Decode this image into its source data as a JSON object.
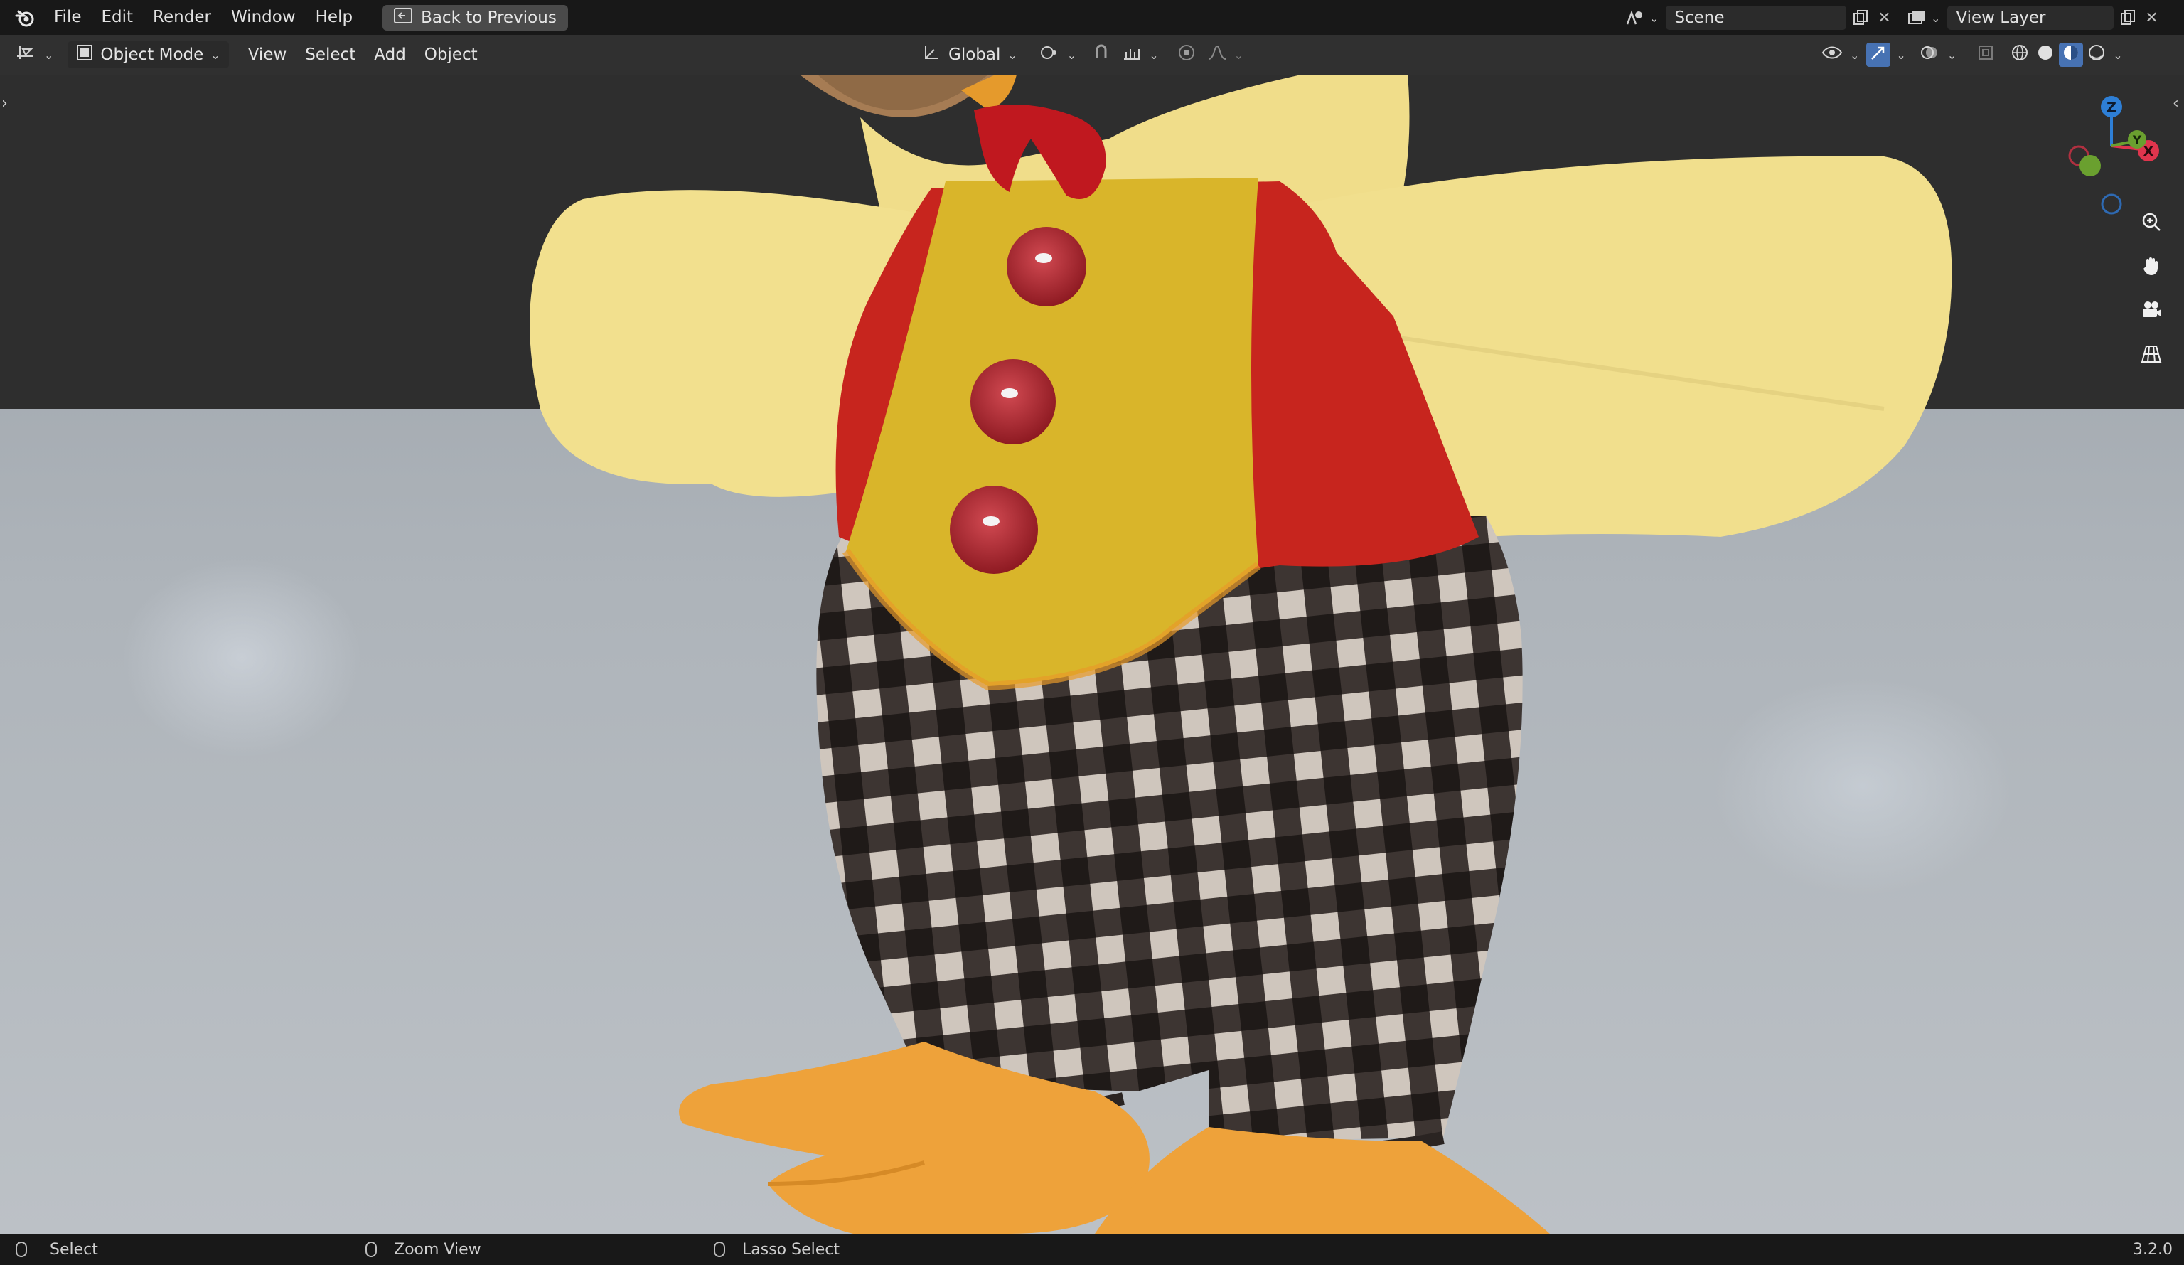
{
  "menu": {
    "items": [
      "File",
      "Edit",
      "Render",
      "Window",
      "Help"
    ],
    "back_button": "Back to Previous"
  },
  "topright": {
    "scene_label": "Scene",
    "view_layer_label": "View Layer"
  },
  "header": {
    "mode": "Object Mode",
    "menus": [
      "View",
      "Select",
      "Add",
      "Object"
    ],
    "transform_orientation": "Global"
  },
  "gizmo": {
    "axes": {
      "x": "X",
      "y": "Y",
      "z": "Z"
    },
    "colors": {
      "x": "#e0354d",
      "y": "#6aa02f",
      "z": "#2e7fd6"
    }
  },
  "statusbar": {
    "left": "Select",
    "middle": "Zoom View",
    "right": "Lasso Select",
    "version": "3.2.0"
  },
  "icons": [
    "blender-logo-icon",
    "editor-type-icon",
    "object-mode-icon",
    "transform-icon",
    "pivot-icon",
    "snap-icon",
    "proportional-icon",
    "visibility-icon",
    "gizmo-icon",
    "overlay-icon",
    "xray-icon",
    "wireframe-shading-icon",
    "solid-shading-icon",
    "material-shading-icon",
    "rendered-shading-icon",
    "zoom-icon",
    "hand-icon",
    "camera-icon",
    "grid-icon"
  ]
}
